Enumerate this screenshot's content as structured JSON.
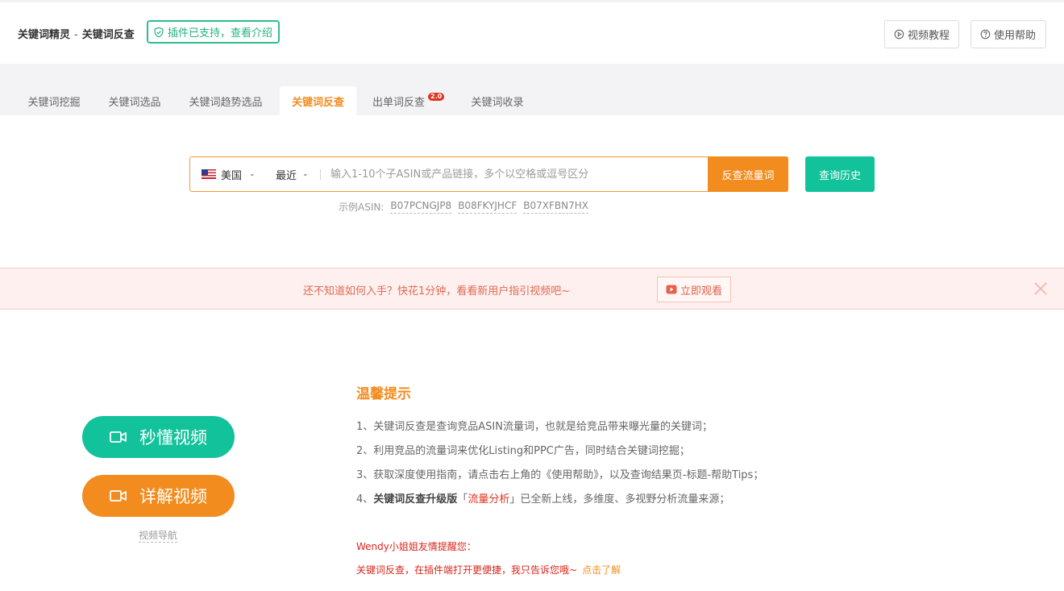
{
  "header": {
    "title_main": "关键词精灵",
    "title_sep": "-",
    "title_sub": "关键词反查",
    "plugin_badge": "插件已支持，查看介绍",
    "video_tutorial": "视频教程",
    "help": "使用帮助"
  },
  "tabs": [
    {
      "label": "关键词挖掘"
    },
    {
      "label": "关键词选品"
    },
    {
      "label": "关键词趋势选品"
    },
    {
      "label": "关键词反查",
      "active": true
    },
    {
      "label": "出单词反查",
      "badge": "2.0"
    },
    {
      "label": "关键词收录"
    }
  ],
  "search": {
    "country": "美国",
    "period": "最近",
    "placeholder": "输入1-10个子ASIN或产品链接，多个以空格或逗号区分",
    "submit_label": "反查流量词",
    "history_label": "查询历史"
  },
  "examples": {
    "label": "示例ASIN:",
    "items": [
      "B07PCNGJP8",
      "B08FKYJHCF",
      "B07XFBN7HX"
    ]
  },
  "notice": {
    "text": "还不知道如何入手？快花1分钟，看看新用户指引视频吧~",
    "watch_label": "立即观看"
  },
  "videos": {
    "quick": "秒懂视频",
    "detail": "详解视频",
    "nav": "视频导航"
  },
  "tips": {
    "title": "温馨提示",
    "t1": "1、关键词反查是查询竞品ASIN流量词，也就是给竞品带来曝光量的关键词；",
    "t2": "2、利用竞品的流量词来优化Listing和PPC广告，同时结合关键词挖掘；",
    "t3": "3、获取深度使用指南，请点击右上角的《使用帮助》，以及查询结果页-标题-帮助Tips；",
    "t4_prefix": "4、",
    "t4_bold": "关键词反查升级版",
    "t4_open": "「",
    "t4_highlight": "流量分析",
    "t4_close": "」",
    "t4_suffix": "已全新上线，多维度、多视野分析流量来源；",
    "wendy_title": "Wendy小姐姐友情提醒您：",
    "wendy_text": "关键词反查，在插件端打开更便捷，我只告诉您哦~",
    "learn_more": "点击了解"
  },
  "colors": {
    "accent_orange": "#f38c1f",
    "accent_green": "#12c29b",
    "alert_red": "#d9261c"
  }
}
